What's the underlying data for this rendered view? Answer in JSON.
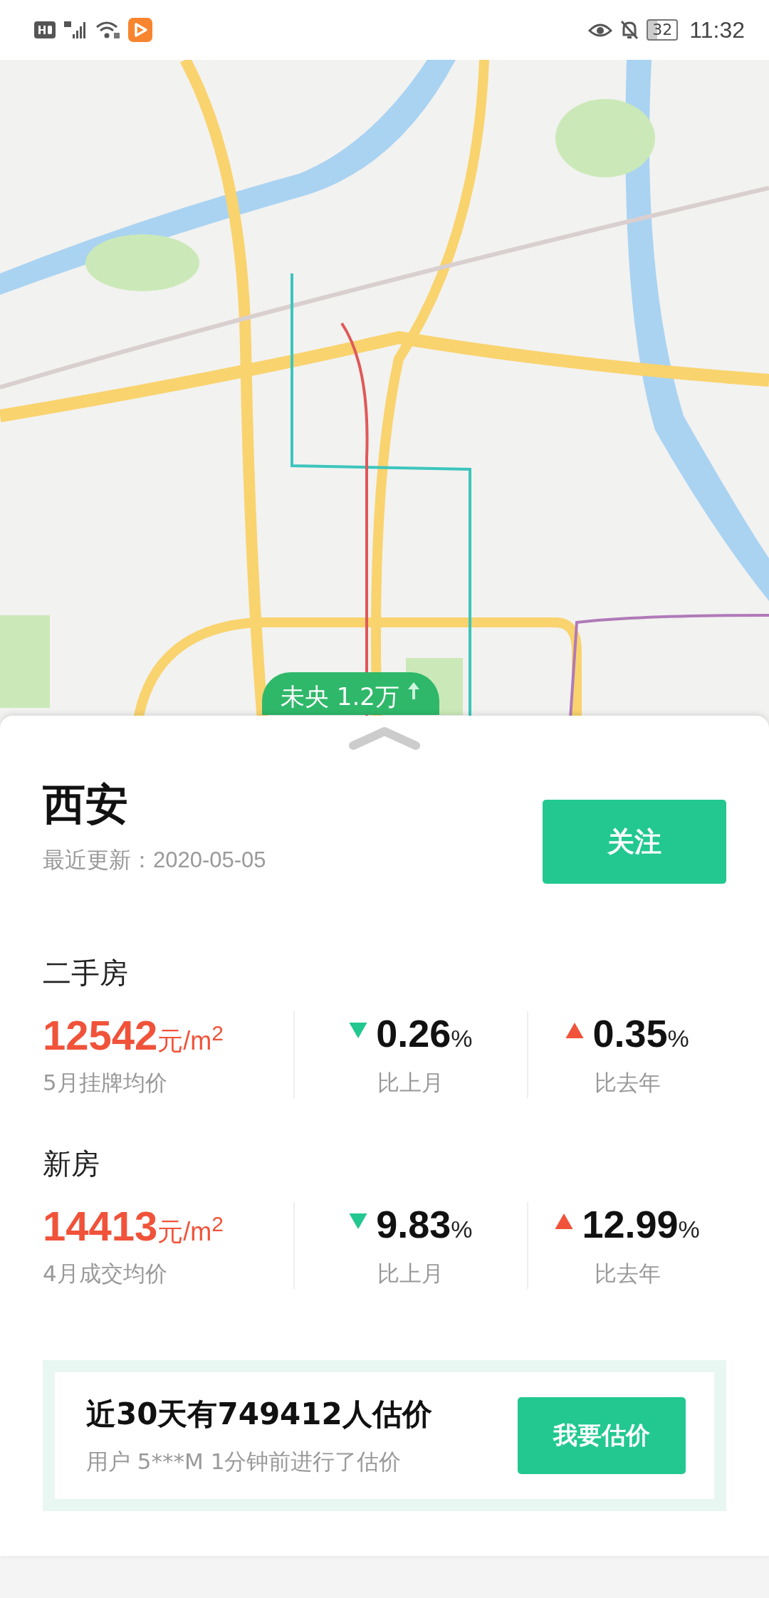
{
  "status_bar": {
    "battery": "32",
    "time": "11:32"
  },
  "map": {
    "kind": "picture",
    "marker": {
      "label": "未央 1.2万"
    }
  },
  "header": {
    "city": "西安",
    "updated": "最近更新：2020-05-05",
    "follow_button": "关注"
  },
  "sections": [
    {
      "title": "二手房",
      "price": "12542",
      "unit": "元/m$^{2}$",
      "price_label": "5月挂牌均价",
      "changes": [
        {
          "rising": false,
          "value": "0.26",
          "unit": "%",
          "label": "比上月"
        },
        {
          "rising": true,
          "value": "0.35",
          "unit": "%",
          "label": "比去年"
        }
      ]
    },
    {
      "title": "新房",
      "price": "14413",
      "unit": "元/m$^{2}$",
      "price_label": "4月成交均价",
      "changes": [
        {
          "rising": false,
          "value": "9.83",
          "unit": "%",
          "label": "比上月"
        },
        {
          "rising": true,
          "value": "12.99",
          "unit": "%",
          "label": "比去年"
        }
      ]
    }
  ],
  "promo": {
    "headline": "近30天有749412人估价",
    "subtext": "用户 5***M 1分钟前进行了估价",
    "button": "我要估价"
  }
}
